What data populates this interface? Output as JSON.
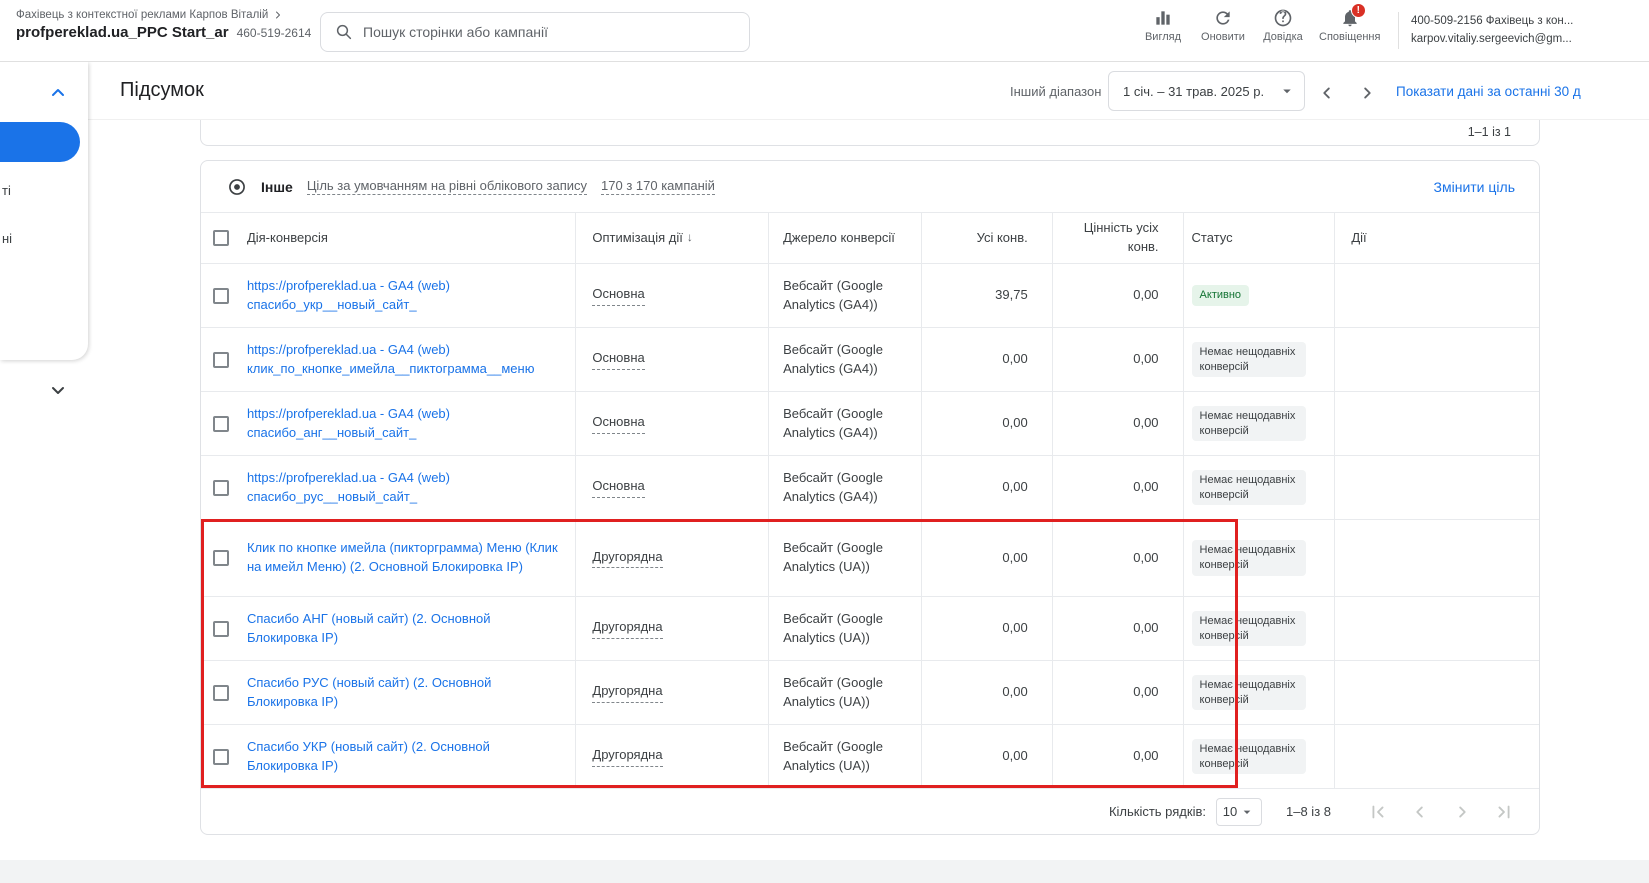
{
  "topbar": {
    "breadcrumb": "Фахівець з контекстної реклами Карпов Віталій",
    "account_name": "profpereklad.ua_PPC Start_ar",
    "account_id": "460-519-2614",
    "search_placeholder": "Пошук сторінки або кампанії",
    "actions": {
      "view": "Вигляд",
      "refresh": "Оновити",
      "help": "Довідка",
      "notifications": "Сповіщення",
      "notification_badge": "!"
    },
    "profile_line1": "400-509-2156 Фахівець з кон...",
    "profile_line2": "karpov.vitaliy.sergeevich@gm..."
  },
  "subheader": {
    "title": "Підсумок",
    "range_label": "Інший діапазон",
    "date_range": "1 січ. – 31 трав. 2025 р.",
    "show_link": "Показати дані за останні 30 д"
  },
  "sidebar": {
    "fragment1": "ті",
    "fragment2": "ні"
  },
  "prev_card": {
    "pagination": "1–1 із 1"
  },
  "goal": {
    "icon": "target-icon",
    "name": "Інше",
    "description": "Ціль за умовчанням на рівні облікового запису",
    "campaigns": "170 з 170 кампаній",
    "change_link": "Змінити ціль"
  },
  "table": {
    "headers": {
      "action": "Дія-конверсія",
      "optimization": "Оптимізація дії",
      "sort_arrow": "↓",
      "source": "Джерело конверсії",
      "all_conv": "Усі конв.",
      "value": "Цінність усіх конв.",
      "status": "Статус",
      "actions": "Дії"
    },
    "rows": [
      {
        "name": "https://profpereklad.ua - GA4 (web) спасибо_укр__новый_сайт_",
        "optimization": "Основна",
        "source": "Вебсайт (Google Analytics (GA4))",
        "all_conv": "39,75",
        "conv_value": "0,00",
        "status": "Активно"
      },
      {
        "name": "https://profpereklad.ua - GA4 (web) клик_по_кнопке_имейла__пиктограмма__меню",
        "optimization": "Основна",
        "source": "Вебсайт (Google Analytics (GA4))",
        "all_conv": "0,00",
        "conv_value": "0,00",
        "status": "Немає нещодавніх конверсій"
      },
      {
        "name": "https://profpereklad.ua - GA4 (web) спасибо_анг__новый_сайт_",
        "optimization": "Основна",
        "source": "Вебсайт (Google Analytics (GA4))",
        "all_conv": "0,00",
        "conv_value": "0,00",
        "status": "Немає нещодавніх конверсій"
      },
      {
        "name": "https://profpereklad.ua - GA4 (web) спасибо_рус__новый_сайт_",
        "optimization": "Основна",
        "source": "Вебсайт (Google Analytics (GA4))",
        "all_conv": "0,00",
        "conv_value": "0,00",
        "status": "Немає нещодавніх конверсій"
      },
      {
        "name": "Клик по кнопке имейла (пикторграмма) Меню (Клик на имейл Меню) (2. Основной Блокировка IP)",
        "optimization": "Другорядна",
        "source": "Вебсайт (Google Analytics (UA))",
        "all_conv": "0,00",
        "conv_value": "0,00",
        "status": "Немає нещодавніх конверсій"
      },
      {
        "name": "Спасибо АНГ (новый сайт) (2. Основной Блокировка IP)",
        "optimization": "Другорядна",
        "source": "Вебсайт (Google Analytics (UA))",
        "all_conv": "0,00",
        "conv_value": "0,00",
        "status": "Немає нещодавніх конверсій"
      },
      {
        "name": "Спасибо РУС (новый сайт) (2. Основной Блокировка IP)",
        "optimization": "Другорядна",
        "source": "Вебсайт (Google Analytics (UA))",
        "all_conv": "0,00",
        "conv_value": "0,00",
        "status": "Немає нещодавніх конверсій"
      },
      {
        "name": "Спасибо УКР (новый сайт) (2. Основной Блокировка IP)",
        "optimization": "Другорядна",
        "source": "Вебсайт (Google Analytics (UA))",
        "all_conv": "0,00",
        "conv_value": "0,00",
        "status": "Немає нещодавніх конверсій"
      }
    ]
  },
  "footer": {
    "rows_label": "Кількість рядків:",
    "rows_per_page": "10",
    "range": "1–8 із 8"
  },
  "colors": {
    "accent_blue": "#1a73e8",
    "annotation_red": "#e02020",
    "status_active_bg": "#e6f4ea",
    "status_active_text": "#137333",
    "status_none_bg": "#f1f3f4"
  }
}
